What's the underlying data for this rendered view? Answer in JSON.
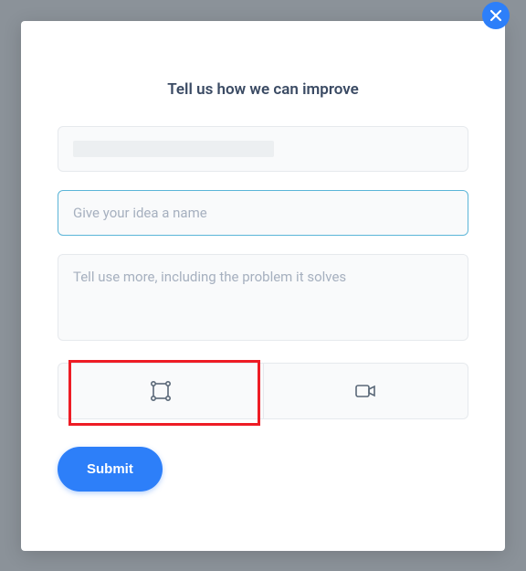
{
  "modal": {
    "title": "Tell us how we can improve",
    "name_input": {
      "value": "",
      "placeholder": "Give your idea a name"
    },
    "detail_input": {
      "value": "",
      "placeholder": "Tell use more, including the problem it solves"
    },
    "submit_label": "Submit"
  }
}
